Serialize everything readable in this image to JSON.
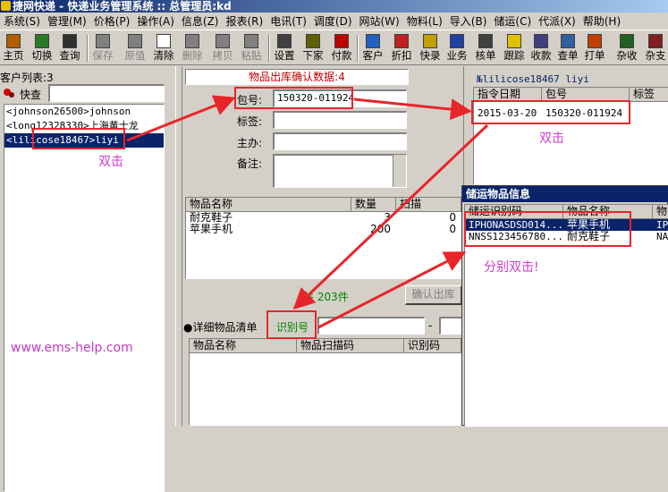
{
  "window": {
    "title": "捷网快递 - 快递业务管理系统 :: 总管理员:kd"
  },
  "menu": [
    "系统(S)",
    "管理(M)",
    "价格(P)",
    "操作(A)",
    "信息(Z)",
    "报表(R)",
    "电讯(T)",
    "调度(D)",
    "网站(W)",
    "物料(L)",
    "导入(B)",
    "储运(C)",
    "代派(X)",
    "帮助(H)"
  ],
  "toolbar": [
    {
      "label": "主页",
      "icon": "home-icon",
      "enabled": true
    },
    {
      "label": "切换",
      "icon": "switch-icon",
      "enabled": true
    },
    {
      "label": "查询",
      "icon": "binoculars-icon",
      "enabled": true
    },
    {
      "label": "保存",
      "icon": "save-icon",
      "enabled": false
    },
    {
      "label": "原值",
      "icon": "undo-icon",
      "enabled": false
    },
    {
      "label": "清除",
      "icon": "clear-icon",
      "enabled": true
    },
    {
      "label": "删除",
      "icon": "delete-icon",
      "enabled": false
    },
    {
      "label": "拷贝",
      "icon": "copy-icon",
      "enabled": false
    },
    {
      "label": "粘贴",
      "icon": "paste-icon",
      "enabled": false
    },
    {
      "label": "设置",
      "icon": "settings-icon",
      "enabled": true
    },
    {
      "label": "下家",
      "icon": "next-agent-icon",
      "enabled": true
    },
    {
      "label": "付款",
      "icon": "payment-icon",
      "enabled": true
    },
    {
      "label": "客户",
      "icon": "customers-icon",
      "enabled": true
    },
    {
      "label": "折扣",
      "icon": "discount-icon",
      "enabled": true
    },
    {
      "label": "快录",
      "icon": "quick-entry-icon",
      "enabled": true
    },
    {
      "label": "业务",
      "icon": "business-icon",
      "enabled": true
    },
    {
      "label": "核单",
      "icon": "check-order-icon",
      "enabled": true
    },
    {
      "label": "跟踪",
      "icon": "track-icon",
      "enabled": true
    },
    {
      "label": "收款",
      "icon": "receive-payment-icon",
      "enabled": true
    },
    {
      "label": "查单",
      "icon": "search-order-icon",
      "enabled": true
    },
    {
      "label": "打单",
      "icon": "print-icon",
      "enabled": true
    },
    {
      "label": "杂收",
      "icon": "misc-income-icon",
      "enabled": true
    },
    {
      "label": "杂支",
      "icon": "misc-expense-icon",
      "enabled": true
    }
  ],
  "customers": {
    "header": "客户列表:3",
    "quick_search_label": "快查",
    "quick_search_value": "",
    "items": [
      "<johnson26500>johnson",
      "<long12328330>上海黄士龙",
      "<lilicose18467>liyi"
    ],
    "selected_index": 2
  },
  "confirm": {
    "title": "物品出库确认数据:4",
    "package_label": "包号:",
    "package_value": "150320-011924",
    "tag_label": "标签:",
    "tag_value": "",
    "handler_label": "主办:",
    "handler_value": "",
    "note_label": "备注:",
    "note_value": ""
  },
  "goods_grid": {
    "headers": [
      "物品名称",
      "数量",
      "扫描"
    ],
    "rows": [
      [
        "耐克鞋子",
        "3",
        "0"
      ],
      [
        "苹果手机",
        "200",
        "0"
      ]
    ]
  },
  "summary": {
    "total_text": "共 203件",
    "confirm_button": "确认出库"
  },
  "detail": {
    "label": "●详细物品清单",
    "id_label": "识别号",
    "id_value": "",
    "dash": "-",
    "headers": [
      "物品名称",
      "物品扫描码",
      "识别码"
    ]
  },
  "watermark": "www.ems-help.com",
  "right_panel": {
    "title": "№lilicose18467 liyi",
    "headers": [
      "指令日期",
      "包号",
      "标签"
    ],
    "rows": [
      [
        "2015-03-20",
        "150320-011924",
        ""
      ]
    ]
  },
  "storage_popup": {
    "title": "储运物品信息",
    "headers": [
      "储运识别码",
      "物品名称",
      "物"
    ],
    "rows": [
      [
        "IPHONASDSD014...",
        "苹果手机",
        "IP"
      ],
      [
        "NNSS123456780...",
        "耐克鞋子",
        "NA"
      ]
    ]
  },
  "annotations": {
    "double_click_1": "双击",
    "double_click_2": "双击",
    "separate_double_click": "分别双击!"
  },
  "colors": {
    "selection": "#0a246a",
    "annotation_red": "#e8252a",
    "annotation_magenta": "#d03ac8",
    "title_red": "#c00000"
  }
}
